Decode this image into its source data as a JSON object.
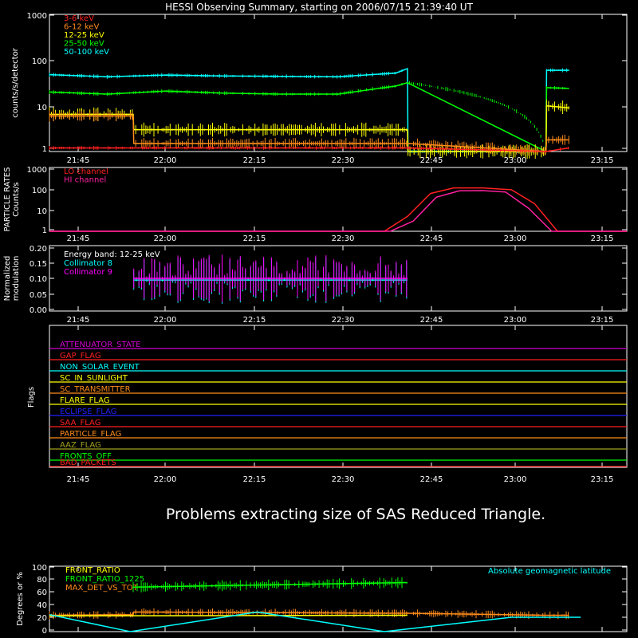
{
  "title": "HESSI Observing Summary, starting on 2006/07/15 21:39:40 UT",
  "message": "Problems extracting size of SAS Reduced Triangle.",
  "time_ticks": [
    "21:45",
    "22:00",
    "22:15",
    "22:30",
    "22:45",
    "23:00",
    "23:15"
  ],
  "panels": {
    "counts": {
      "ylabel": "counts/s/detector",
      "yticks": [
        "1",
        "10",
        "100",
        "1000"
      ],
      "legend": [
        {
          "label": "3-6 keV",
          "color": "#ff2020"
        },
        {
          "label": "6-12 keV",
          "color": "#ff8c1a"
        },
        {
          "label": "12-25 keV",
          "color": "#ffff00"
        },
        {
          "label": "25-50 keV",
          "color": "#00ff00"
        },
        {
          "label": "50-100 keV",
          "color": "#00ffff"
        }
      ]
    },
    "particle": {
      "ylabel": "PARTICLE RATES",
      "ylabel2": "Counts/s",
      "yticks": [
        "1",
        "10",
        "100",
        "1000"
      ],
      "legend": [
        {
          "label": "LO channel",
          "color": "#ff2020"
        },
        {
          "label": "HI channel",
          "color": "#ff20a0"
        }
      ]
    },
    "modulation": {
      "ylabel": "Normalized",
      "ylabel2": "modulation",
      "yticks": [
        "0.00",
        "0.05",
        "0.10",
        "0.15",
        "0.20"
      ],
      "legend": [
        {
          "label": "Energy band: 12-25 keV",
          "color": "#ffffff"
        },
        {
          "label": "Collimator 8",
          "color": "#00ffff"
        },
        {
          "label": "Collimator 9",
          "color": "#ff00ff"
        }
      ]
    },
    "flags": {
      "ylabel": "Flags",
      "items": [
        {
          "label": "ATTENUATOR_STATE",
          "color": "#d000d0"
        },
        {
          "label": "GAP_FLAG",
          "color": "#ff2020"
        },
        {
          "label": "NON_SOLAR_EVENT",
          "color": "#00ffff"
        },
        {
          "label": "SC_IN_SUNLIGHT",
          "color": "#ffff00"
        },
        {
          "label": "SC_TRANSMITTER",
          "color": "#ff8c1a"
        },
        {
          "label": "FLARE_FLAG",
          "color": "#ffff00"
        },
        {
          "label": "ECLIPSE_FLAG",
          "color": "#2020ff"
        },
        {
          "label": "SAA_FLAG",
          "color": "#ff2020"
        },
        {
          "label": "PARTICLE_FLAG",
          "color": "#ff8c1a"
        },
        {
          "label": "AAZ_FLAG",
          "color": "#a0a020"
        },
        {
          "label": "FRONTS_OFF",
          "color": "#00ff00"
        },
        {
          "label": "BAD_PACKETS",
          "color": "#ff2020"
        }
      ]
    },
    "ratio": {
      "ylabel": "Degrees or %",
      "yticks": [
        "0",
        "20",
        "40",
        "60",
        "80",
        "100"
      ],
      "legend": [
        {
          "label": "FRONT_RATIO",
          "color": "#ffff00"
        },
        {
          "label": "FRONT_RATIO_1225",
          "color": "#00ff00"
        },
        {
          "label": "MAX_DET_VS_TOT",
          "color": "#ff8c1a"
        }
      ],
      "legend_right": {
        "label": "Absolute geomagnetic latitude",
        "color": "#00ffff"
      }
    }
  },
  "chart_data": [
    {
      "type": "line",
      "panel": "counts",
      "xlabel": "",
      "ylabel": "counts/s/detector",
      "y_scale": "log",
      "ylim": [
        1,
        1000
      ],
      "x_unit": "minutes after 21:39:40 UT",
      "xlim": [
        0,
        100
      ],
      "series": [
        {
          "name": "50-100 keV",
          "color": "#00ffff",
          "x": [
            0,
            10,
            20,
            30,
            40,
            50,
            60,
            62,
            62.1,
            86,
            86.1,
            90
          ],
          "y": [
            48,
            43,
            47,
            45,
            44,
            43,
            52,
            65,
            1,
            1,
            60,
            60
          ]
        },
        {
          "name": "25-50 keV",
          "color": "#00ff00",
          "x": [
            0,
            10,
            20,
            30,
            40,
            50,
            60,
            62,
            86,
            86.1,
            90
          ],
          "y": [
            20,
            18,
            21,
            19,
            18,
            18,
            27,
            32,
            1,
            25,
            24
          ]
        },
        {
          "name": "12-25 keV",
          "color": "#ffff00",
          "x": [
            0,
            14.5,
            14.6,
            30,
            45,
            62,
            62.1,
            86,
            86.1,
            90
          ],
          "y": [
            6.5,
            6.5,
            3,
            3,
            3,
            3,
            1,
            1,
            10,
            9
          ]
        },
        {
          "name": "6-12 keV",
          "color": "#ff8c1a",
          "x": [
            0,
            14.5,
            14.6,
            62,
            86,
            86.1,
            90
          ],
          "y": [
            6,
            6,
            1.5,
            1.5,
            1,
            1.8,
            1.8
          ]
        },
        {
          "name": "3-6 keV",
          "color": "#ff2020",
          "x": [
            0,
            62,
            86,
            90
          ],
          "y": [
            1.2,
            1.2,
            1,
            1.2
          ]
        }
      ]
    },
    {
      "type": "line",
      "panel": "particle",
      "ylabel": "Counts/s",
      "y_scale": "log",
      "ylim": [
        1,
        1000
      ],
      "x_unit": "minutes after 21:39:40 UT",
      "xlim": [
        0,
        100
      ],
      "series": [
        {
          "name": "LO channel",
          "color": "#ff2020",
          "x": [
            0,
            58,
            62,
            66,
            70,
            75,
            80,
            84,
            88,
            100
          ],
          "y": [
            1,
            1,
            5,
            60,
            110,
            110,
            90,
            20,
            1,
            1
          ]
        },
        {
          "name": "HI channel",
          "color": "#ff20a0",
          "x": [
            0,
            59,
            63,
            67,
            71,
            75,
            79,
            83,
            87,
            100
          ],
          "y": [
            1,
            1,
            3,
            40,
            80,
            82,
            70,
            12,
            1,
            1
          ]
        }
      ]
    },
    {
      "type": "line",
      "panel": "modulation",
      "ylabel": "modulation",
      "ylim": [
        0,
        0.2
      ],
      "x_unit": "minutes after 21:39:40 UT",
      "xlim": [
        0,
        100
      ],
      "series": [
        {
          "name": "Collimator 8",
          "color": "#00ffff",
          "x": [
            14.6,
            62
          ],
          "y": [
            0.095,
            0.095
          ]
        },
        {
          "name": "Collimator 9",
          "color": "#ff00ff",
          "x": [
            14.6,
            62
          ],
          "y": [
            0.1,
            0.1
          ]
        }
      ]
    },
    {
      "type": "line",
      "panel": "ratio",
      "ylabel": "Degrees or %",
      "ylim": [
        0,
        100
      ],
      "x_unit": "minutes after 21:39:40 UT",
      "xlim": [
        0,
        100
      ],
      "series": [
        {
          "name": "FRONT_RATIO_1225",
          "color": "#00ff00",
          "x": [
            14.5,
            62
          ],
          "y": [
            68,
            75
          ]
        },
        {
          "name": "MAX_DET_VS_TOT",
          "color": "#ff8c1a",
          "x": [
            0,
            14.5,
            14.6,
            62,
            86,
            90
          ],
          "y": [
            25,
            26,
            30,
            28,
            25,
            25
          ]
        },
        {
          "name": "FRONT_RATIO",
          "color": "#ffff00",
          "x": [
            0,
            62
          ],
          "y": [
            24,
            25
          ]
        },
        {
          "name": "Absolute geomagnetic latitude",
          "color": "#00ffff",
          "x": [
            0,
            14,
            36,
            58,
            80,
            92
          ],
          "y": [
            26,
            0,
            30,
            0,
            22,
            22
          ]
        }
      ]
    }
  ]
}
